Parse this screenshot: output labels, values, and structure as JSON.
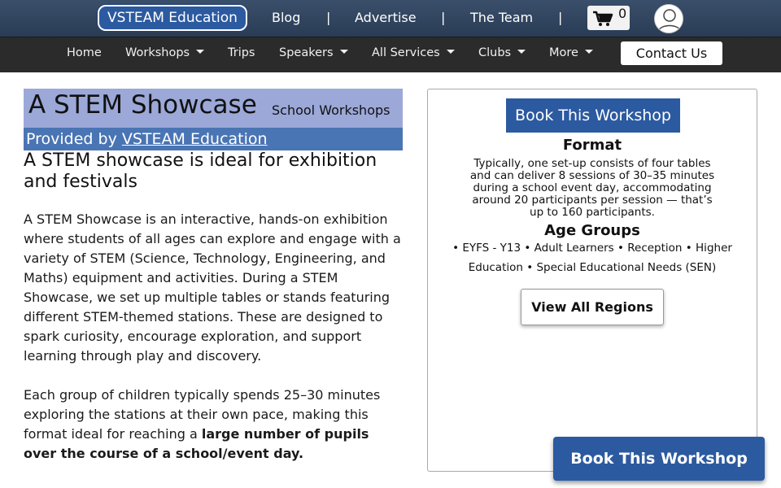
{
  "topbar": {
    "brand": "VSTEAM Education",
    "links": [
      "Blog",
      "Advertise",
      "The Team"
    ],
    "separator": "|",
    "cart_count": "0"
  },
  "navbar": {
    "items": [
      {
        "label": "Home"
      },
      {
        "label": "Workshops"
      },
      {
        "label": "Trips"
      },
      {
        "label": "Speakers"
      },
      {
        "label": "All Services"
      },
      {
        "label": "Clubs"
      },
      {
        "label": "More"
      }
    ],
    "contact": "Contact Us"
  },
  "header": {
    "title": "A STEM Showcase",
    "category": "School Workshops",
    "provided_by": "Provided by",
    "provider": "VSTEAM Education"
  },
  "main": {
    "subheading": "A STEM showcase is ideal for exhibition and festivals",
    "para1": "A STEM Showcase is an interactive, hands-on exhibition where students of all ages can explore and engage with a variety of STEM (Science, Technology, Engineering, and Maths) equipment and activities. During a STEM Showcase, we set up multiple tables or stands featuring different STEM-themed stations. These are designed to spark curiosity, encourage exploration, and support learning through play and discovery.",
    "para2_start": "Each group of children typically spends 25–30 minutes exploring the stations at their own pace, making this format ideal for reaching a ",
    "para2_bold": "large number of pupils over the course of a school/event day."
  },
  "sidebar": {
    "book_button": "Book This Workshop",
    "format_heading": "Format",
    "format_text": "Typically, one set-up consists of four tables and can deliver 8 sessions of 30–35 minutes during a school event day, accommodating around 20 participants per session — that’s up to 160 participants.",
    "age_heading": "Age Groups",
    "age_text": "• EYFS - Y13 • Adult Learners • Reception • Higher Education • Special Educational Needs (SEN)",
    "regions_button": "View All Regions"
  },
  "floating": {
    "book_button": "Book This Workshop"
  },
  "colors": {
    "topbar": "#2f4460",
    "navbar": "#2b2b2b",
    "brand_blue": "#2c5aa0",
    "title_bg": "#9ba8d8",
    "provider_bg": "#4a75b4"
  }
}
